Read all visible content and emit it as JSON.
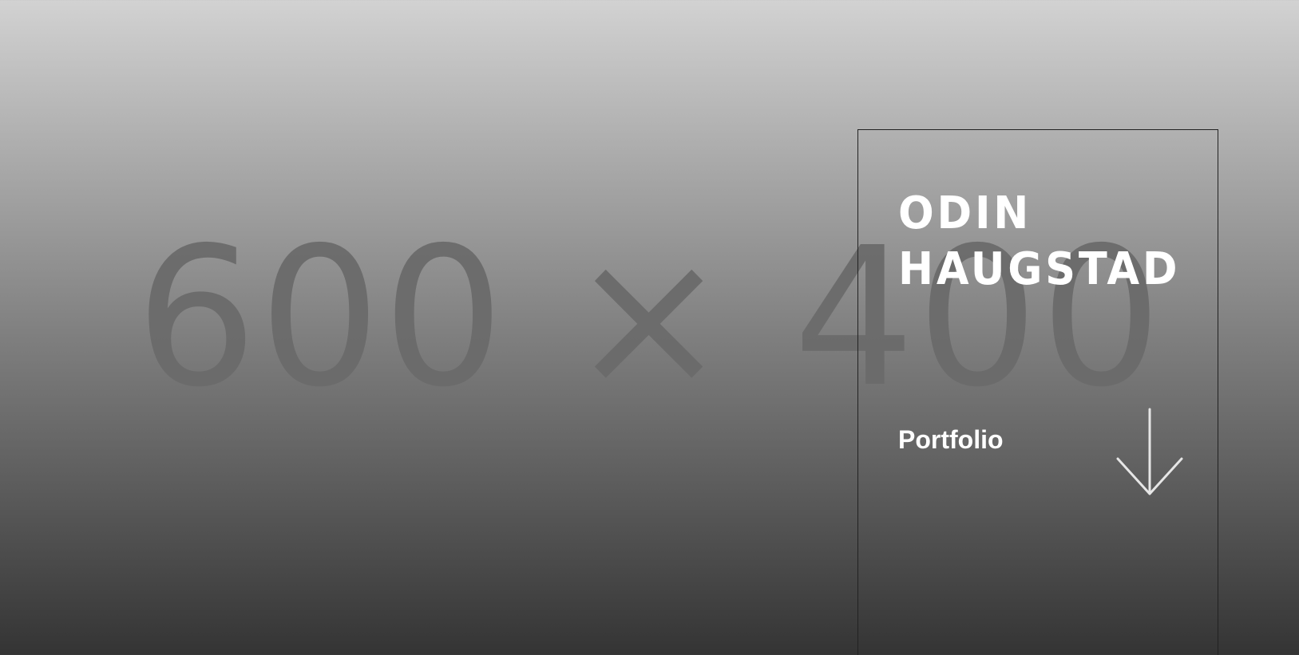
{
  "hero": {
    "placeholder_text": "600 × 400"
  },
  "card": {
    "name_line1": "ODIN",
    "name_line2": "HAUGSTAD",
    "subtitle": "Portfolio",
    "scroll_icon": "arrow-down-icon"
  },
  "colors": {
    "text": "#ffffff",
    "placeholder": "#6b6b6b",
    "card_border": "#222222",
    "arrow": "#e6e6e6"
  }
}
